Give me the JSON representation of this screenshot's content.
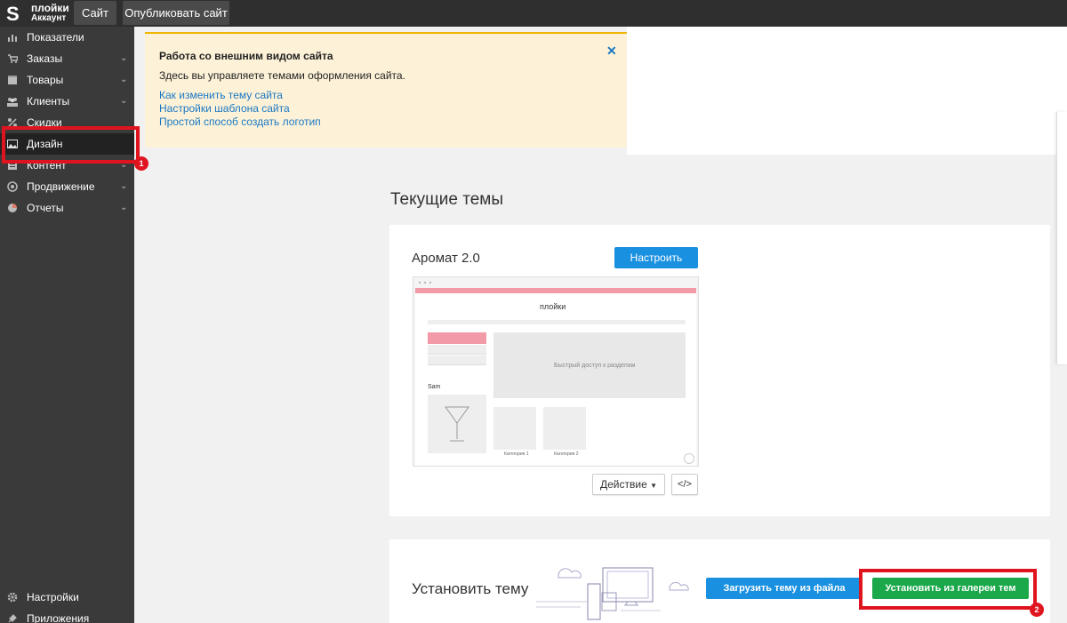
{
  "header": {
    "logo_letter": "S",
    "store_name": "плойки",
    "account_label": "Аккаунт",
    "site_button": "Сайт",
    "publish_button": "Опубликовать сайт"
  },
  "sidebar": {
    "items": [
      {
        "label": "Показатели",
        "icon": "chart-icon",
        "chevron": ""
      },
      {
        "label": "Заказы",
        "icon": "cart-icon",
        "chevron": "⌄"
      },
      {
        "label": "Товары",
        "icon": "box-icon",
        "chevron": "⌄"
      },
      {
        "label": "Клиенты",
        "icon": "users-icon",
        "chevron": "⌄"
      },
      {
        "label": "Скидки",
        "icon": "discount-icon",
        "chevron": ""
      },
      {
        "label": "Дизайн",
        "icon": "image-icon",
        "chevron": ""
      },
      {
        "label": "Контент",
        "icon": "content-icon",
        "chevron": "⌄"
      },
      {
        "label": "Продвижение",
        "icon": "target-icon",
        "chevron": "⌄"
      },
      {
        "label": "Отчеты",
        "icon": "pie-icon",
        "chevron": "⌄"
      }
    ],
    "bottom_items": [
      {
        "label": "Настройки",
        "icon": "gear-icon"
      },
      {
        "label": "Приложения",
        "icon": "plug-icon"
      }
    ],
    "active_item": "Дизайн"
  },
  "annotations": {
    "badge_1": "1",
    "badge_2": "2",
    "highlight_color": "#e0141e"
  },
  "info_box": {
    "title": "Работа со внешним видом сайта",
    "text": "Здесь вы управляете темами оформления сайта.",
    "links": [
      "Как изменить тему сайта",
      "Настройки шаблона сайта",
      "Простой способ создать логотип"
    ],
    "close": "✕"
  },
  "current_themes": {
    "heading": "Текущие темы",
    "theme_name": "Аромат 2.0",
    "configure_button": "Настроить",
    "action_button": "Действие",
    "code_button": "</>",
    "preview": {
      "store_title": "плойки",
      "banner_text": "Быстрый доступ к разделам",
      "category_heading": "Sam",
      "category_1": "Категория 1",
      "category_2": "Категория 2"
    }
  },
  "install": {
    "title": "Установить тему",
    "upload_button": "Загрузить тему из файла",
    "gallery_button": "Установить из галереи тем"
  },
  "colors": {
    "accent_blue": "#1a90e0",
    "accent_green": "#1aa84a",
    "sidebar": "#3a3a3a",
    "topbar": "#2f2f2f",
    "info_bg": "#fdf2d8"
  }
}
